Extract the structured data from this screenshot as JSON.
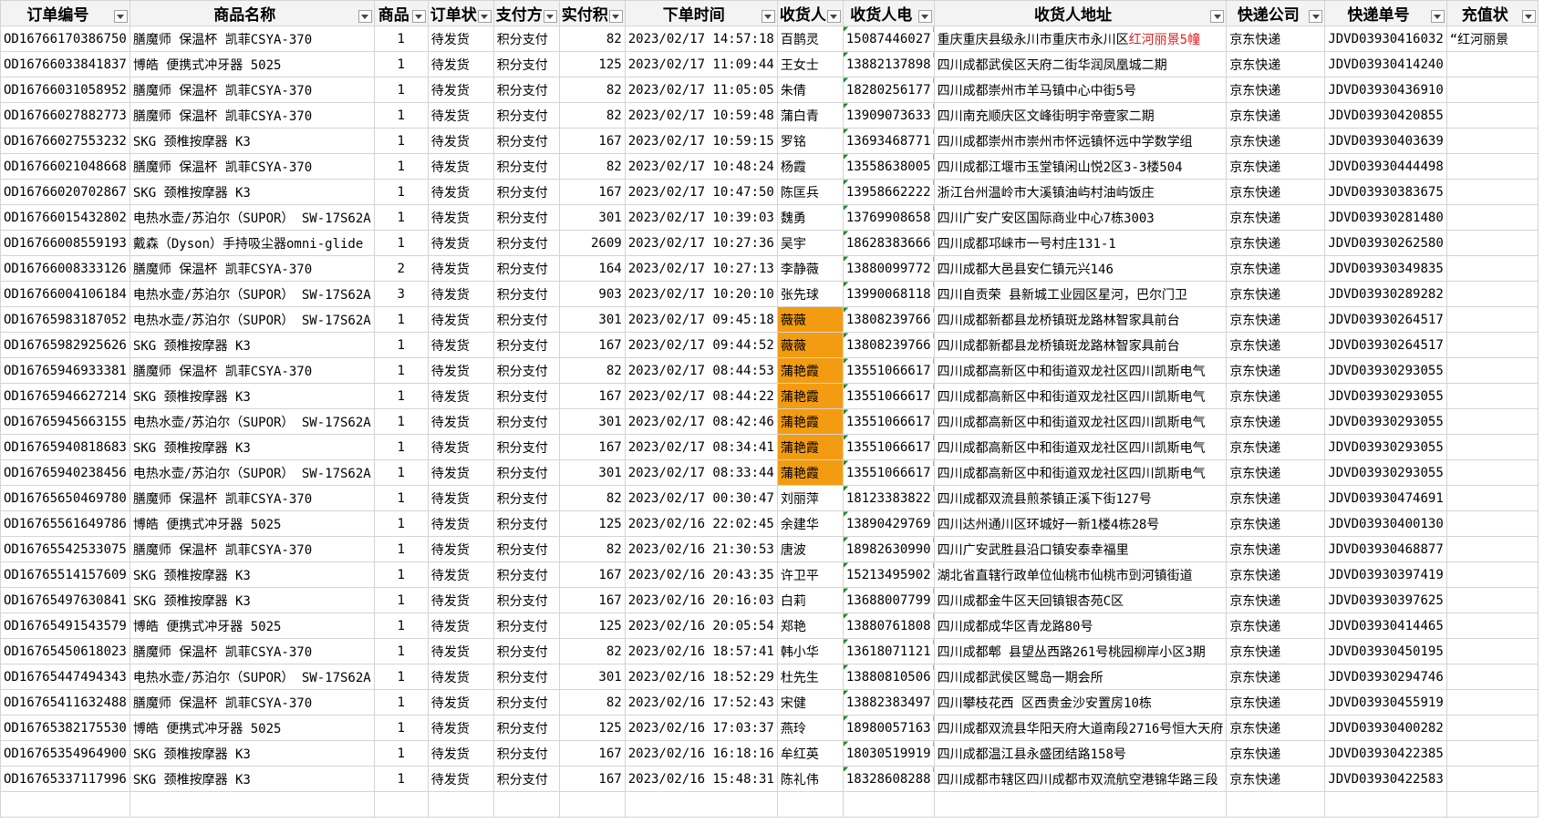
{
  "headers": [
    "订单编号",
    "商品名称",
    "商品",
    "订单状",
    "支付方",
    "实付积",
    "下单时间",
    "收货人",
    "收货人电",
    "收货人地址",
    "快递公司",
    "快递单号",
    "充值状"
  ],
  "rows": [
    {
      "id": "OD16766170386750",
      "product": "膳魔师 保温杯 凯菲CSYA-370",
      "qty": "1",
      "status": "待发货",
      "pay": "积分支付",
      "points": "82",
      "time": "2023/02/17 14:57:18",
      "name": "百鹊灵",
      "phone": "15087446027",
      "addr": "重庆重庆县级永川市重庆市永川区",
      "addr_red": "红河丽景5幢",
      "courier": "京东快递",
      "tracking": "JDVD03930416032",
      "recharge": "“红河丽景",
      "hl": false
    },
    {
      "id": "OD16766033841837",
      "product": "博皓 便携式冲牙器 5025",
      "qty": "1",
      "status": "待发货",
      "pay": "积分支付",
      "points": "125",
      "time": "2023/02/17 11:09:44",
      "name": "王女士",
      "phone": "13882137898",
      "addr": "四川成都武侯区天府二街华润凤凰城二期",
      "addr_red": "",
      "courier": "京东快递",
      "tracking": "JDVD03930414240",
      "recharge": "",
      "hl": false
    },
    {
      "id": "OD16766031058952",
      "product": "膳魔师 保温杯 凯菲CSYA-370",
      "qty": "1",
      "status": "待发货",
      "pay": "积分支付",
      "points": "82",
      "time": "2023/02/17 11:05:05",
      "name": "朱倩",
      "phone": "18280256177",
      "addr": "四川成都崇州市羊马镇中心中街5号",
      "addr_red": "",
      "courier": "京东快递",
      "tracking": "JDVD03930436910",
      "recharge": "",
      "hl": false
    },
    {
      "id": "OD16766027882773",
      "product": "膳魔师 保温杯 凯菲CSYA-370",
      "qty": "1",
      "status": "待发货",
      "pay": "积分支付",
      "points": "82",
      "time": "2023/02/17 10:59:48",
      "name": "蒲白青",
      "phone": "13909073633",
      "addr": "四川南充顺庆区文峰街明宇帝壹家二期",
      "addr_red": "",
      "courier": "京东快递",
      "tracking": "JDVD03930420855",
      "recharge": "",
      "hl": false
    },
    {
      "id": "OD16766027553232",
      "product": "SKG 颈椎按摩器 K3",
      "qty": "1",
      "status": "待发货",
      "pay": "积分支付",
      "points": "167",
      "time": "2023/02/17 10:59:15",
      "name": "罗铭",
      "phone": "13693468771",
      "addr": "四川成都崇州市崇州市怀远镇怀远中学数学组",
      "addr_red": "",
      "courier": "京东快递",
      "tracking": "JDVD03930403639",
      "recharge": "",
      "hl": false
    },
    {
      "id": "OD16766021048668",
      "product": "膳魔师 保温杯 凯菲CSYA-370",
      "qty": "1",
      "status": "待发货",
      "pay": "积分支付",
      "points": "82",
      "time": "2023/02/17 10:48:24",
      "name": "杨霞",
      "phone": "13558638005",
      "addr": "四川成都江堰市玉堂镇闲山悦2区3-3楼504",
      "addr_red": "",
      "courier": "京东快递",
      "tracking": "JDVD03930444498",
      "recharge": "",
      "hl": false
    },
    {
      "id": "OD16766020702867",
      "product": "SKG 颈椎按摩器 K3",
      "qty": "1",
      "status": "待发货",
      "pay": "积分支付",
      "points": "167",
      "time": "2023/02/17 10:47:50",
      "name": "陈匡兵",
      "phone": "13958662222",
      "addr": "浙江台州温岭市大溪镇油屿村油屿饭庄",
      "addr_red": "",
      "courier": "京东快递",
      "tracking": "JDVD03930383675",
      "recharge": "",
      "hl": false
    },
    {
      "id": "OD16766015432802",
      "product": "电热水壶/苏泊尔（SUPOR） SW-17S62A",
      "qty": "1",
      "status": "待发货",
      "pay": "积分支付",
      "points": "301",
      "time": "2023/02/17 10:39:03",
      "name": "魏勇",
      "phone": "13769908658",
      "addr": "四川广安广安区国际商业中心7栋3003",
      "addr_red": "",
      "courier": "京东快递",
      "tracking": "JDVD03930281480",
      "recharge": "",
      "hl": false
    },
    {
      "id": "OD16766008559193",
      "product": "戴森（Dyson）手持吸尘器omni-glide",
      "qty": "1",
      "status": "待发货",
      "pay": "积分支付",
      "points": "2609",
      "time": "2023/02/17 10:27:36",
      "name": "吴宇",
      "phone": "18628383666",
      "addr": "四川成都邛崃市一号村庄131-1",
      "addr_red": "",
      "courier": "京东快递",
      "tracking": "JDVD03930262580",
      "recharge": "",
      "hl": false
    },
    {
      "id": "OD16766008333126",
      "product": "膳魔师 保温杯 凯菲CSYA-370",
      "qty": "2",
      "status": "待发货",
      "pay": "积分支付",
      "points": "164",
      "time": "2023/02/17 10:27:13",
      "name": "李静薇",
      "phone": "13880099772",
      "addr": "四川成都大邑县安仁镇元兴146",
      "addr_red": "",
      "courier": "京东快递",
      "tracking": "JDVD03930349835",
      "recharge": "",
      "hl": false
    },
    {
      "id": "OD16766004106184",
      "product": "电热水壶/苏泊尔（SUPOR） SW-17S62A",
      "qty": "3",
      "status": "待发货",
      "pay": "积分支付",
      "points": "903",
      "time": "2023/02/17 10:20:10",
      "name": "张先球",
      "phone": "13990068118",
      "addr": "四川自贡荣  县新城工业园区星河，巴尔门卫",
      "addr_red": "",
      "courier": "京东快递",
      "tracking": "JDVD03930289282",
      "recharge": "",
      "hl": false
    },
    {
      "id": "OD16765983187052",
      "product": "电热水壶/苏泊尔（SUPOR） SW-17S62A",
      "qty": "1",
      "status": "待发货",
      "pay": "积分支付",
      "points": "301",
      "time": "2023/02/17 09:45:18",
      "name": "薇薇",
      "phone": "13808239766",
      "addr": "四川成都新都县龙桥镇斑龙路林智家具前台",
      "addr_red": "",
      "courier": "京东快递",
      "tracking": "JDVD03930264517",
      "recharge": "",
      "hl": true
    },
    {
      "id": "OD16765982925626",
      "product": "SKG 颈椎按摩器 K3",
      "qty": "1",
      "status": "待发货",
      "pay": "积分支付",
      "points": "167",
      "time": "2023/02/17 09:44:52",
      "name": "薇薇",
      "phone": "13808239766",
      "addr": "四川成都新都县龙桥镇斑龙路林智家具前台",
      "addr_red": "",
      "courier": "京东快递",
      "tracking": "JDVD03930264517",
      "recharge": "",
      "hl": true
    },
    {
      "id": "OD16765946933381",
      "product": "膳魔师 保温杯 凯菲CSYA-370",
      "qty": "1",
      "status": "待发货",
      "pay": "积分支付",
      "points": "82",
      "time": "2023/02/17 08:44:53",
      "name": "蒲艳霞",
      "phone": "13551066617",
      "addr": "四川成都高新区中和街道双龙社区四川凯斯电气",
      "addr_red": "",
      "courier": "京东快递",
      "tracking": "JDVD03930293055",
      "recharge": "",
      "hl": true
    },
    {
      "id": "OD16765946627214",
      "product": "SKG 颈椎按摩器 K3",
      "qty": "1",
      "status": "待发货",
      "pay": "积分支付",
      "points": "167",
      "time": "2023/02/17 08:44:22",
      "name": "蒲艳霞",
      "phone": "13551066617",
      "addr": "四川成都高新区中和街道双龙社区四川凯斯电气",
      "addr_red": "",
      "courier": "京东快递",
      "tracking": "JDVD03930293055",
      "recharge": "",
      "hl": true
    },
    {
      "id": "OD16765945663155",
      "product": "电热水壶/苏泊尔（SUPOR） SW-17S62A",
      "qty": "1",
      "status": "待发货",
      "pay": "积分支付",
      "points": "301",
      "time": "2023/02/17 08:42:46",
      "name": "蒲艳霞",
      "phone": "13551066617",
      "addr": "四川成都高新区中和街道双龙社区四川凯斯电气",
      "addr_red": "",
      "courier": "京东快递",
      "tracking": "JDVD03930293055",
      "recharge": "",
      "hl": true
    },
    {
      "id": "OD16765940818683",
      "product": "SKG 颈椎按摩器 K3",
      "qty": "1",
      "status": "待发货",
      "pay": "积分支付",
      "points": "167",
      "time": "2023/02/17 08:34:41",
      "name": "蒲艳霞",
      "phone": "13551066617",
      "addr": "四川成都高新区中和街道双龙社区四川凯斯电气",
      "addr_red": "",
      "courier": "京东快递",
      "tracking": "JDVD03930293055",
      "recharge": "",
      "hl": true
    },
    {
      "id": "OD16765940238456",
      "product": "电热水壶/苏泊尔（SUPOR） SW-17S62A",
      "qty": "1",
      "status": "待发货",
      "pay": "积分支付",
      "points": "301",
      "time": "2023/02/17 08:33:44",
      "name": "蒲艳霞",
      "phone": "13551066617",
      "addr": "四川成都高新区中和街道双龙社区四川凯斯电气",
      "addr_red": "",
      "courier": "京东快递",
      "tracking": "JDVD03930293055",
      "recharge": "",
      "hl": true
    },
    {
      "id": "OD16765650469780",
      "product": "膳魔师 保温杯 凯菲CSYA-370",
      "qty": "1",
      "status": "待发货",
      "pay": "积分支付",
      "points": "82",
      "time": "2023/02/17 00:30:47",
      "name": "刘丽萍",
      "phone": "18123383822",
      "addr": "四川成都双流县煎茶镇正溪下街127号",
      "addr_red": "",
      "courier": "京东快递",
      "tracking": "JDVD03930474691",
      "recharge": "",
      "hl": false
    },
    {
      "id": "OD16765561649786",
      "product": "博皓 便携式冲牙器 5025",
      "qty": "1",
      "status": "待发货",
      "pay": "积分支付",
      "points": "125",
      "time": "2023/02/16 22:02:45",
      "name": "余建华",
      "phone": "13890429769",
      "addr": "四川达州通川区环城好一新1楼4栋28号",
      "addr_red": "",
      "courier": "京东快递",
      "tracking": "JDVD03930400130",
      "recharge": "",
      "hl": false
    },
    {
      "id": "OD16765542533075",
      "product": "膳魔师 保温杯 凯菲CSYA-370",
      "qty": "1",
      "status": "待发货",
      "pay": "积分支付",
      "points": "82",
      "time": "2023/02/16 21:30:53",
      "name": "唐波",
      "phone": "18982630990",
      "addr": "四川广安武胜县沿口镇安泰幸福里",
      "addr_red": "",
      "courier": "京东快递",
      "tracking": "JDVD03930468877",
      "recharge": "",
      "hl": false
    },
    {
      "id": "OD16765514157609",
      "product": "SKG 颈椎按摩器 K3",
      "qty": "1",
      "status": "待发货",
      "pay": "积分支付",
      "points": "167",
      "time": "2023/02/16 20:43:35",
      "name": "许卫平",
      "phone": "15213495902",
      "addr": "湖北省直辖行政单位仙桃市仙桃市剅河镇街道",
      "addr_red": "",
      "courier": "京东快递",
      "tracking": "JDVD03930397419",
      "recharge": "",
      "hl": false
    },
    {
      "id": "OD16765497630841",
      "product": "SKG 颈椎按摩器 K3",
      "qty": "1",
      "status": "待发货",
      "pay": "积分支付",
      "points": "167",
      "time": "2023/02/16 20:16:03",
      "name": "白莉",
      "phone": "13688007799",
      "addr": "四川成都金牛区天回镇银杏苑C区",
      "addr_red": "",
      "courier": "京东快递",
      "tracking": "JDVD03930397625",
      "recharge": "",
      "hl": false
    },
    {
      "id": "OD16765491543579",
      "product": "博皓 便携式冲牙器 5025",
      "qty": "1",
      "status": "待发货",
      "pay": "积分支付",
      "points": "125",
      "time": "2023/02/16 20:05:54",
      "name": "郑艳",
      "phone": "13880761808",
      "addr": "四川成都成华区青龙路80号",
      "addr_red": "",
      "courier": "京东快递",
      "tracking": "JDVD03930414465",
      "recharge": "",
      "hl": false
    },
    {
      "id": "OD16765450618023",
      "product": "膳魔师 保温杯 凯菲CSYA-370",
      "qty": "1",
      "status": "待发货",
      "pay": "积分支付",
      "points": "82",
      "time": "2023/02/16 18:57:41",
      "name": "韩小华",
      "phone": "13618071121",
      "addr": "四川成都郫  县望丛西路261号桃园柳岸小区3期",
      "addr_red": "",
      "courier": "京东快递",
      "tracking": "JDVD03930450195",
      "recharge": "",
      "hl": false
    },
    {
      "id": "OD16765447494343",
      "product": "电热水壶/苏泊尔（SUPOR） SW-17S62A",
      "qty": "1",
      "status": "待发货",
      "pay": "积分支付",
      "points": "301",
      "time": "2023/02/16 18:52:29",
      "name": "杜先生",
      "phone": "13880810506",
      "addr": "四川成都武侯区鹭岛一期会所",
      "addr_red": "",
      "courier": "京东快递",
      "tracking": "JDVD03930294746",
      "recharge": "",
      "hl": false
    },
    {
      "id": "OD16765411632488",
      "product": "膳魔师 保温杯 凯菲CSYA-370",
      "qty": "1",
      "status": "待发货",
      "pay": "积分支付",
      "points": "82",
      "time": "2023/02/16 17:52:43",
      "name": "宋健",
      "phone": "13882383497",
      "addr": "四川攀枝花西   区西贵金沙安置房10栋",
      "addr_red": "",
      "courier": "京东快递",
      "tracking": "JDVD03930455919",
      "recharge": "",
      "hl": false
    },
    {
      "id": "OD16765382175530",
      "product": "博皓 便携式冲牙器 5025",
      "qty": "1",
      "status": "待发货",
      "pay": "积分支付",
      "points": "125",
      "time": "2023/02/16 17:03:37",
      "name": "燕玲",
      "phone": "18980057163",
      "addr": "四川成都双流县华阳天府大道南段2716号恒大天府",
      "addr_red": "",
      "courier": "京东快递",
      "tracking": "JDVD03930400282",
      "recharge": "",
      "hl": false
    },
    {
      "id": "OD16765354964900",
      "product": "SKG 颈椎按摩器 K3",
      "qty": "1",
      "status": "待发货",
      "pay": "积分支付",
      "points": "167",
      "time": "2023/02/16 16:18:16",
      "name": "牟红英",
      "phone": "18030519919",
      "addr": "四川成都温江县永盛团结路158号",
      "addr_red": "",
      "courier": "京东快递",
      "tracking": "JDVD03930422385",
      "recharge": "",
      "hl": false
    },
    {
      "id": "OD16765337117996",
      "product": "SKG 颈椎按摩器 K3",
      "qty": "1",
      "status": "待发货",
      "pay": "积分支付",
      "points": "167",
      "time": "2023/02/16 15:48:31",
      "name": "陈礼伟",
      "phone": "18328608288",
      "addr": "四川成都市辖区四川成都市双流航空港锦华路三段",
      "addr_red": "",
      "courier": "京东快递",
      "tracking": "JDVD03930422583",
      "recharge": "",
      "hl": false
    }
  ]
}
